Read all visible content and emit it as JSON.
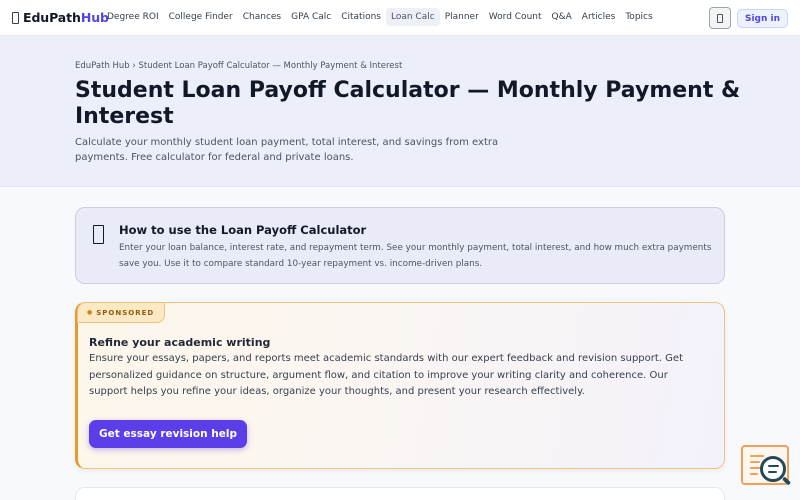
{
  "header": {
    "brand_part1": "EduPath",
    "brand_part2": "Hub",
    "nav": [
      {
        "label": "Degree ROI"
      },
      {
        "label": "College Finder"
      },
      {
        "label": "Chances"
      },
      {
        "label": "GPA Calc"
      },
      {
        "label": "Citations"
      },
      {
        "label": "Loan Calc",
        "active": true
      },
      {
        "label": "Planner"
      },
      {
        "label": "Word Count"
      },
      {
        "label": "Q&A"
      },
      {
        "label": "Articles"
      },
      {
        "label": "Topics"
      }
    ],
    "theme_icon": "theme-toggle-icon",
    "signin_label": "Sign in"
  },
  "hero": {
    "breadcrumb": "EduPath Hub › Student Loan Payoff Calculator — Monthly Payment & Interest",
    "title": "Student Loan Payoff Calculator — Monthly Payment & Interest",
    "subtitle": "Calculate your monthly student loan payment, total interest, and savings from extra payments. Free calculator for federal and private loans."
  },
  "howto": {
    "icon": "book-icon",
    "title": "How to use the Loan Payoff Calculator",
    "text": "Enter your loan balance, interest rate, and repayment term. See your monthly payment, total interest, and how much extra payments save you. Use it to compare standard 10-year repayment vs. income-driven plans."
  },
  "sponsored": {
    "badge": "SPONSORED",
    "badge_icon": "star-icon",
    "title": "Refine your academic writing",
    "text": "Ensure your essays, papers, and reports meet academic standards with our expert feedback and revision support. Get personalized guidance on structure, argument flow, and citation to improve your writing clarity and coherence. Our support helps you refine your ideas, organize your thoughts, and present your research effectively.",
    "cta": "Get essay revision help"
  },
  "colors": {
    "accent": "#4f46e5",
    "cta": "#5b3ee8",
    "sponsor_border": "#e59b2f"
  }
}
